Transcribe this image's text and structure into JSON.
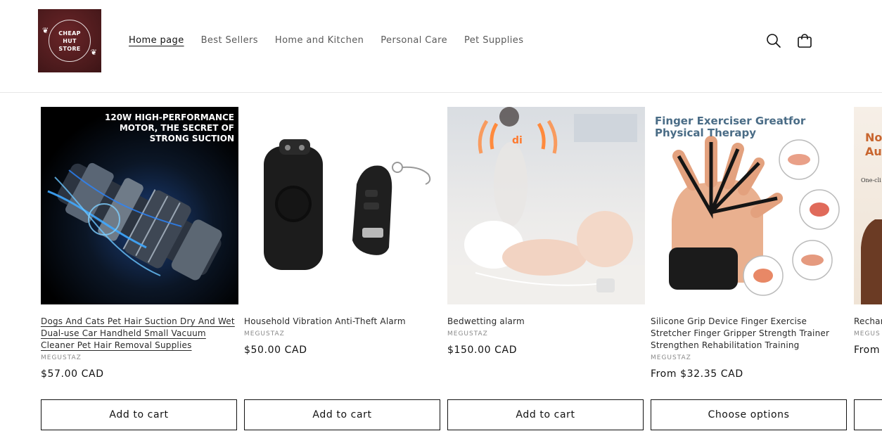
{
  "header": {
    "logo_text": "CHEAP\nHUT\nSTORE",
    "nav": [
      {
        "label": "Home page",
        "active": true
      },
      {
        "label": "Best Sellers",
        "active": false
      },
      {
        "label": "Home and Kitchen",
        "active": false
      },
      {
        "label": "Personal Care",
        "active": false
      },
      {
        "label": "Pet Supplies",
        "active": false
      }
    ],
    "icons": [
      "search-icon",
      "cart-icon"
    ]
  },
  "products": [
    {
      "title": "Dogs And Cats Pet Hair Suction Dry And Wet Dual-use Car Handheld Small Vacuum Cleaner Pet Hair Removal Supplies",
      "vendor": "MEGUSTAZ",
      "price": "$57.00 CAD",
      "button": "Add to cart",
      "image_caption": "120W HIGH-PERFORMANCE\nMOTOR, THE SECRET OF\nSTRONG SUCTION"
    },
    {
      "title": "Household Vibration Anti-Theft Alarm",
      "vendor": "MEGUSTAZ",
      "price": "$50.00 CAD",
      "button": "Add to cart"
    },
    {
      "title": "Bedwetting alarm",
      "vendor": "MEGUSTAZ",
      "price": "$150.00 CAD",
      "button": "Add to cart",
      "image_caption": "di"
    },
    {
      "title": "Silicone Grip Device Finger Exercise Stretcher Finger Gripper Strength Trainer Strengthen Rehabilitation Training",
      "vendor": "MEGUSTAZ",
      "price": "From $32.35 CAD",
      "button": "Choose options",
      "image_caption": "Finger Exerciser Greatfor\nPhysical Therapy"
    },
    {
      "title": "Rechar Coffee Lazy M",
      "vendor": "MEGUS",
      "price": "From",
      "button": "",
      "image_caption": "No\nAut",
      "image_small": "One-cli"
    }
  ],
  "colors": {
    "logo_bg": "#4b1a1c",
    "text": "#121212",
    "muted": "#5a5a5a",
    "vendor": "#8a8a8a",
    "border": "#121212"
  }
}
